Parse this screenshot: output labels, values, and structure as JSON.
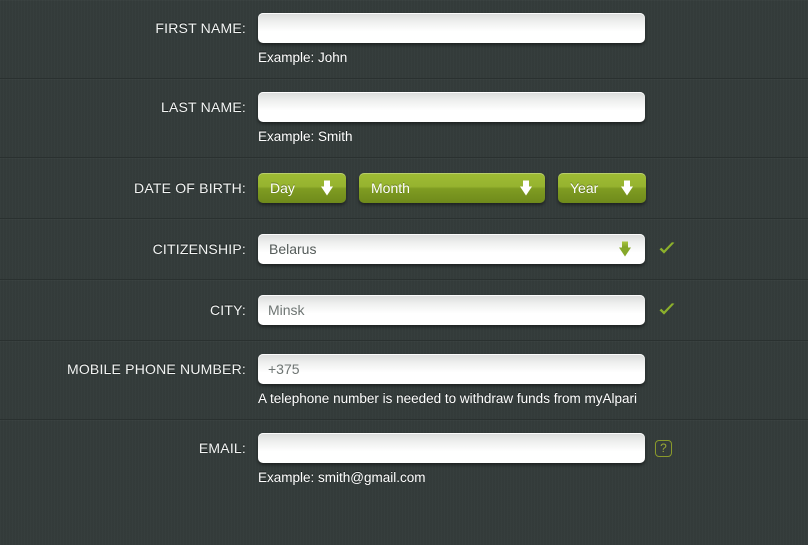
{
  "form": {
    "rows": [
      {
        "label": "FIRST NAME:",
        "type": "text",
        "value": "",
        "placeholder": "",
        "hint": "Example: John",
        "check": false,
        "help": false
      },
      {
        "label": "LAST NAME:",
        "type": "text",
        "value": "",
        "placeholder": "",
        "hint": "Example: Smith",
        "check": false,
        "help": false
      },
      {
        "label": "DATE OF BIRTH:",
        "type": "date",
        "day_label": "Day",
        "month_label": "Month",
        "year_label": "Year",
        "hint": "",
        "check": false,
        "help": false
      },
      {
        "label": "CITIZENSHIP:",
        "type": "select",
        "value": "Belarus",
        "hint": "",
        "check": true,
        "help": false
      },
      {
        "label": "CITY:",
        "type": "text",
        "value": "Minsk",
        "placeholder": "Minsk",
        "hint": "",
        "check": true,
        "help": false
      },
      {
        "label": "MOBILE PHONE NUMBER:",
        "type": "text",
        "value": "+375",
        "placeholder": "+375",
        "hint": "A telephone number is needed to withdraw funds from myAlpari",
        "check": false,
        "help": false
      },
      {
        "label": "EMAIL:",
        "type": "text",
        "value": "",
        "placeholder": "",
        "hint": "Example: smith@gmail.com",
        "check": false,
        "help": true
      }
    ],
    "icons": {
      "dropdown_arrow": "arrow-down-icon",
      "valid_check": "check-icon",
      "help": "help-icon"
    },
    "help_symbol": "?",
    "colors": {
      "background": "#343c3b",
      "divider": "#2a3130",
      "accent_green": "#96b32f",
      "check_green": "#8cb02c",
      "input_text": "#4b5250",
      "label_text": "#f2f4f3"
    }
  }
}
